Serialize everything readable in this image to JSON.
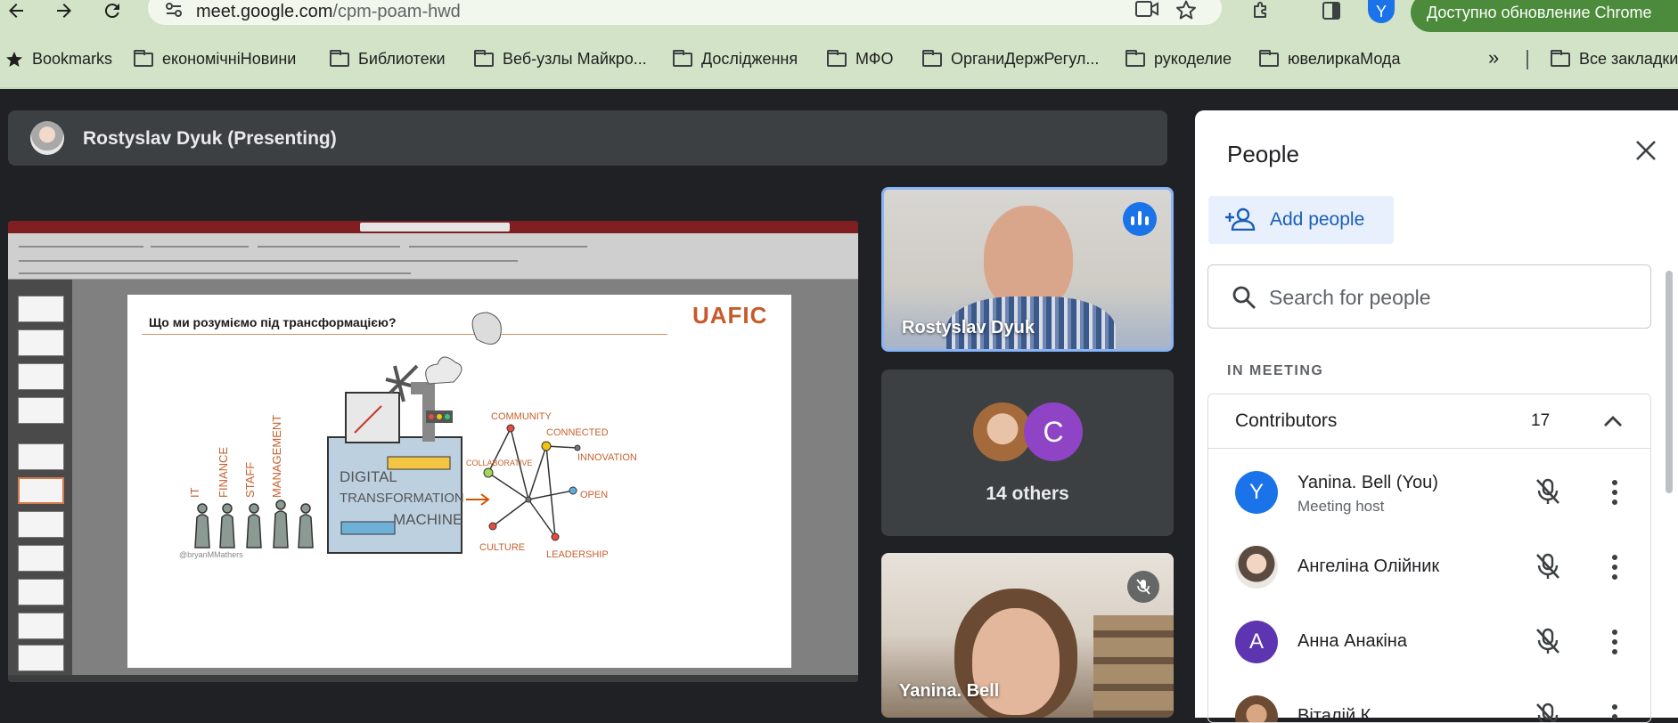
{
  "browser": {
    "url_host": "meet.google.com",
    "url_path": "/cpm-poam-hwd",
    "profile_initial": "Y",
    "update_label": "Доступно обновление Chrome",
    "bookmarks": [
      "Bookmarks",
      "економічніНовини",
      "Библиотеки",
      "Веб-узлы Майкро...",
      "Дослідження",
      "МФО",
      "ОрганиДержРегул...",
      "рукоделие",
      "ювелиркаМода",
      "Все закладки"
    ],
    "overflow_label": "»"
  },
  "meet": {
    "presenter_label": "Rostyslav Dyuk (Presenting)",
    "slide": {
      "title": "Що ми розуміємо під трансформацією?",
      "logo": "UAFIC",
      "graphic_labels": [
        "IT",
        "FINANCE",
        "STAFF",
        "MANAGEMENT",
        "DIGITAL",
        "TRANSFORMATION",
        "MACHINE",
        "COMMUNITY",
        "CONNECTED",
        "INNOVATION",
        "COLLABORATIVE",
        "OPEN",
        "CULTURE",
        "LEADERSHIP",
        "@bryanMMathers"
      ]
    },
    "tiles": {
      "speaker_name": "Rostyslav Dyuk",
      "others_label": "14 others",
      "others_initial": "C",
      "self_name": "Yanina. Bell"
    },
    "colors": {
      "accent": "#1a73e8",
      "others_avatar": "#8e44c4",
      "speaking_border": "#8ab4f8"
    }
  },
  "people_panel": {
    "title": "People",
    "add_people": "Add people",
    "search_placeholder": "Search for people",
    "section_label": "IN MEETING",
    "contributors_label": "Contributors",
    "contributors_count": "17",
    "participants": [
      {
        "name": "Yanina. Bell (You)",
        "subtitle": "Meeting host",
        "initial": "Y",
        "avatar_color": "#1a73e8"
      },
      {
        "name": "Ангеліна Олійник",
        "subtitle": "",
        "initial": "",
        "avatar_color": "#e9e3de"
      },
      {
        "name": "Анна Анакіна",
        "subtitle": "",
        "initial": "А",
        "avatar_color": "#5e35b1"
      },
      {
        "name": "Віталій К...",
        "subtitle": "",
        "initial": "",
        "avatar_color": "#b07a55"
      }
    ]
  }
}
